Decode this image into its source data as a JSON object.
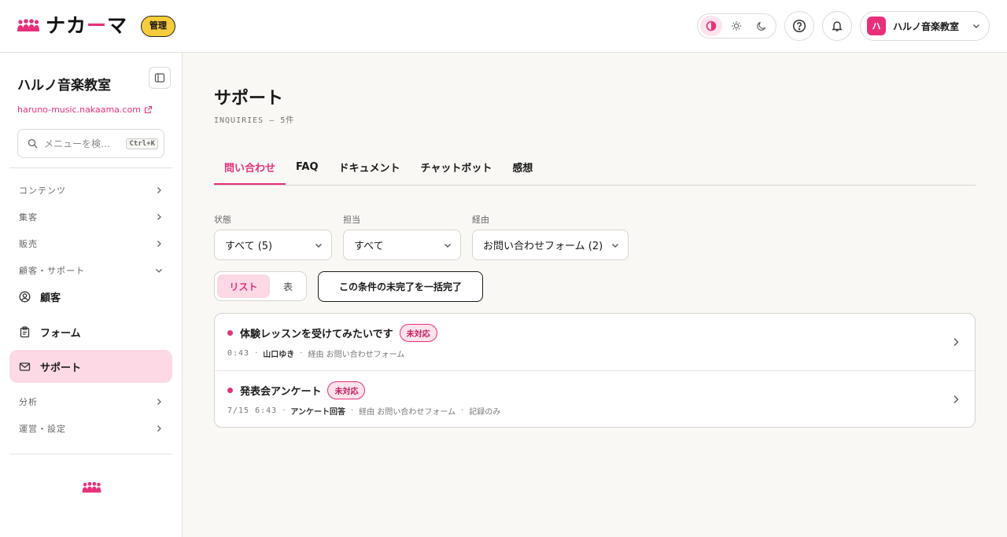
{
  "header": {
    "logo_icon": "people-group-icon",
    "logo_text_a": "ナカ",
    "logo_text_b": "ー",
    "logo_text_c": "マ",
    "admin_badge": "管理",
    "theme_icons": [
      "contrast-icon",
      "sun-icon",
      "moon-icon"
    ],
    "help_icon": "help-icon",
    "bell_icon": "bell-icon",
    "account": {
      "avatar_text": "ハ",
      "name": "ハルノ音楽教室"
    }
  },
  "sidebar": {
    "school_name": "ハルノ音楽教室",
    "site_link": "haruno-music.nakaama.com",
    "search": {
      "placeholder": "メニューを検…",
      "shortcut": "Ctrl+K"
    },
    "groups_top": [
      "コンテンツ",
      "集客",
      "販売"
    ],
    "expanded_group": "顧客・サポート",
    "nav_items": [
      {
        "label": "顧客",
        "icon": "user-circle-icon"
      },
      {
        "label": "フォーム",
        "icon": "clipboard-icon"
      },
      {
        "label": "サポート",
        "icon": "mail-icon"
      }
    ],
    "groups_bottom": [
      "分析",
      "運営・設定"
    ]
  },
  "main": {
    "title": "サポート",
    "subtitle": "INQUIRIES — 5件",
    "tabs": [
      "問い合わせ",
      "FAQ",
      "ドキュメント",
      "チャットボット",
      "感想"
    ],
    "filters": [
      {
        "label": "状態",
        "value": "すべて (5)"
      },
      {
        "label": "担当",
        "value": "すべて"
      },
      {
        "label": "経由",
        "value": "お問い合わせフォーム (2)"
      }
    ],
    "view_toggle": [
      "リスト",
      "表"
    ],
    "bulk_button": "この条件の未完了を一括完了",
    "inquiries": [
      {
        "title": "体験レッスンを受けてみたいです",
        "status": "未対応",
        "time": "0:43",
        "sender": "山口ゆき",
        "via": "経由 お問い合わせフォーム",
        "extra": ""
      },
      {
        "title": "発表会アンケート",
        "status": "未対応",
        "time": "7/15 6:43",
        "sender": "アンケート回答",
        "via": "経由 お問い合わせフォーム",
        "extra": "記録のみ"
      }
    ]
  },
  "colors": {
    "accent": "#e8307a",
    "badge_yellow": "#f5cc3b",
    "active_bg": "#fcd9e5"
  }
}
